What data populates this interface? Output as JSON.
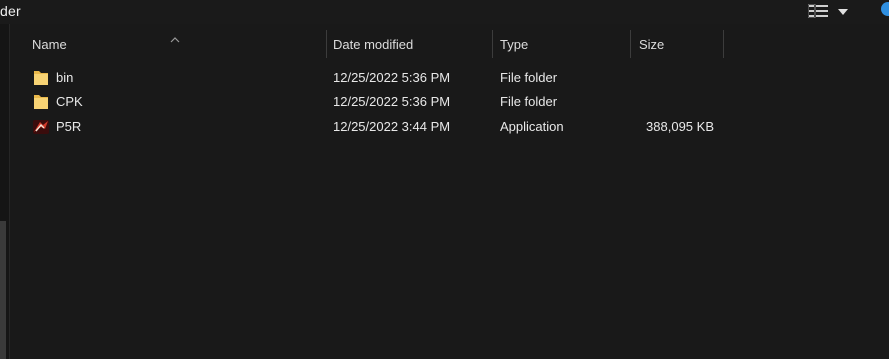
{
  "window": {
    "title_fragment": "der"
  },
  "toolbar": {
    "view_toggle_icon": "details-view-icon",
    "view_dropdown_icon": "chevron-down-icon"
  },
  "columns": {
    "name": "Name",
    "date_modified": "Date modified",
    "type": "Type",
    "size": "Size"
  },
  "files": [
    {
      "name": "bin",
      "date": "12/25/2022 5:36 PM",
      "type": "File folder",
      "size": "",
      "icon": "folder-icon"
    },
    {
      "name": "CPK",
      "date": "12/25/2022 5:36 PM",
      "type": "File folder",
      "size": "",
      "icon": "folder-icon"
    },
    {
      "name": "P5R",
      "date": "12/25/2022 3:44 PM",
      "type": "Application",
      "size": "388,095 KB",
      "icon": "application-icon"
    }
  ],
  "colors": {
    "background": "#191919",
    "folder": "#f2c65a",
    "accent": "#2f8fe0"
  }
}
